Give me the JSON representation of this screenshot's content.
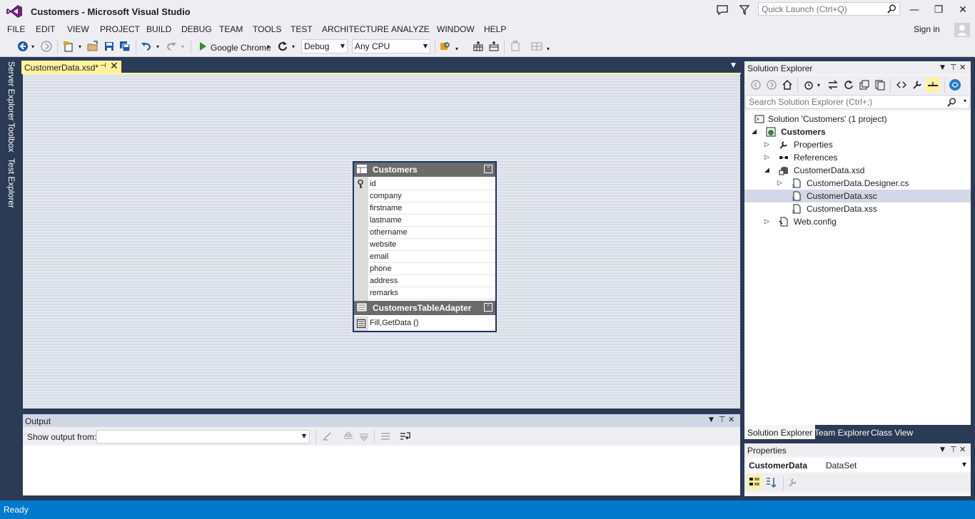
{
  "window": {
    "title": "Customers - Microsoft Visual Studio",
    "quick_launch_placeholder": "Quick Launch (Ctrl+Q)",
    "minimize": "—",
    "restore": "❐",
    "close": "✕"
  },
  "menu": {
    "items": [
      "FILE",
      "EDIT",
      "VIEW",
      "PROJECT",
      "BUILD",
      "DEBUG",
      "TEAM",
      "TOOLS",
      "TEST",
      "ARCHITECTURE",
      "ANALYZE",
      "WINDOW",
      "HELP"
    ],
    "sign_in": "Sign in"
  },
  "toolbar": {
    "run_target": "Google Chrome",
    "configuration": "Debug",
    "platform": "Any CPU"
  },
  "left_rail": {
    "tabs": [
      "Server Explorer",
      "Toolbox",
      "Test Explorer"
    ]
  },
  "document": {
    "tab_label": "CustomerData.xsd*"
  },
  "designer": {
    "table": {
      "name": "Customers",
      "columns": [
        "id",
        "company",
        "firstname",
        "lastname",
        "othername",
        "website",
        "email",
        "phone",
        "address",
        "remarks"
      ]
    },
    "adapter": {
      "name": "CustomersTableAdapter",
      "methods": "Fill,GetData ()"
    }
  },
  "output": {
    "title": "Output",
    "show_from_label": "Show output from:",
    "show_from_value": ""
  },
  "solution_explorer": {
    "title": "Solution Explorer",
    "search_placeholder": "Search Solution Explorer (Ctrl+;)",
    "tree": [
      {
        "label": "Solution 'Customers' (1 project)",
        "bold": false,
        "selected": false
      },
      {
        "label": "Customers",
        "bold": true,
        "selected": false
      },
      {
        "label": "Properties",
        "bold": false,
        "selected": false
      },
      {
        "label": "References",
        "bold": false,
        "selected": false
      },
      {
        "label": "CustomerData.xsd",
        "bold": false,
        "selected": false
      },
      {
        "label": "CustomerData.Designer.cs",
        "bold": false,
        "selected": false
      },
      {
        "label": "CustomerData.xsc",
        "bold": false,
        "selected": true
      },
      {
        "label": "CustomerData.xss",
        "bold": false,
        "selected": false
      },
      {
        "label": "Web.config",
        "bold": false,
        "selected": false
      }
    ],
    "bottom_tabs": [
      "Solution Explorer",
      "Team Explorer",
      "Class View"
    ]
  },
  "properties": {
    "title": "Properties",
    "object_name": "CustomerData",
    "object_type": "DataSet"
  },
  "status": {
    "text": "Ready"
  },
  "colors": {
    "accent": "#007acc",
    "frame": "#2b3a55",
    "chrome": "#eeeef2",
    "doc_tab": "#fff29d",
    "table_border": "#1e3464"
  }
}
